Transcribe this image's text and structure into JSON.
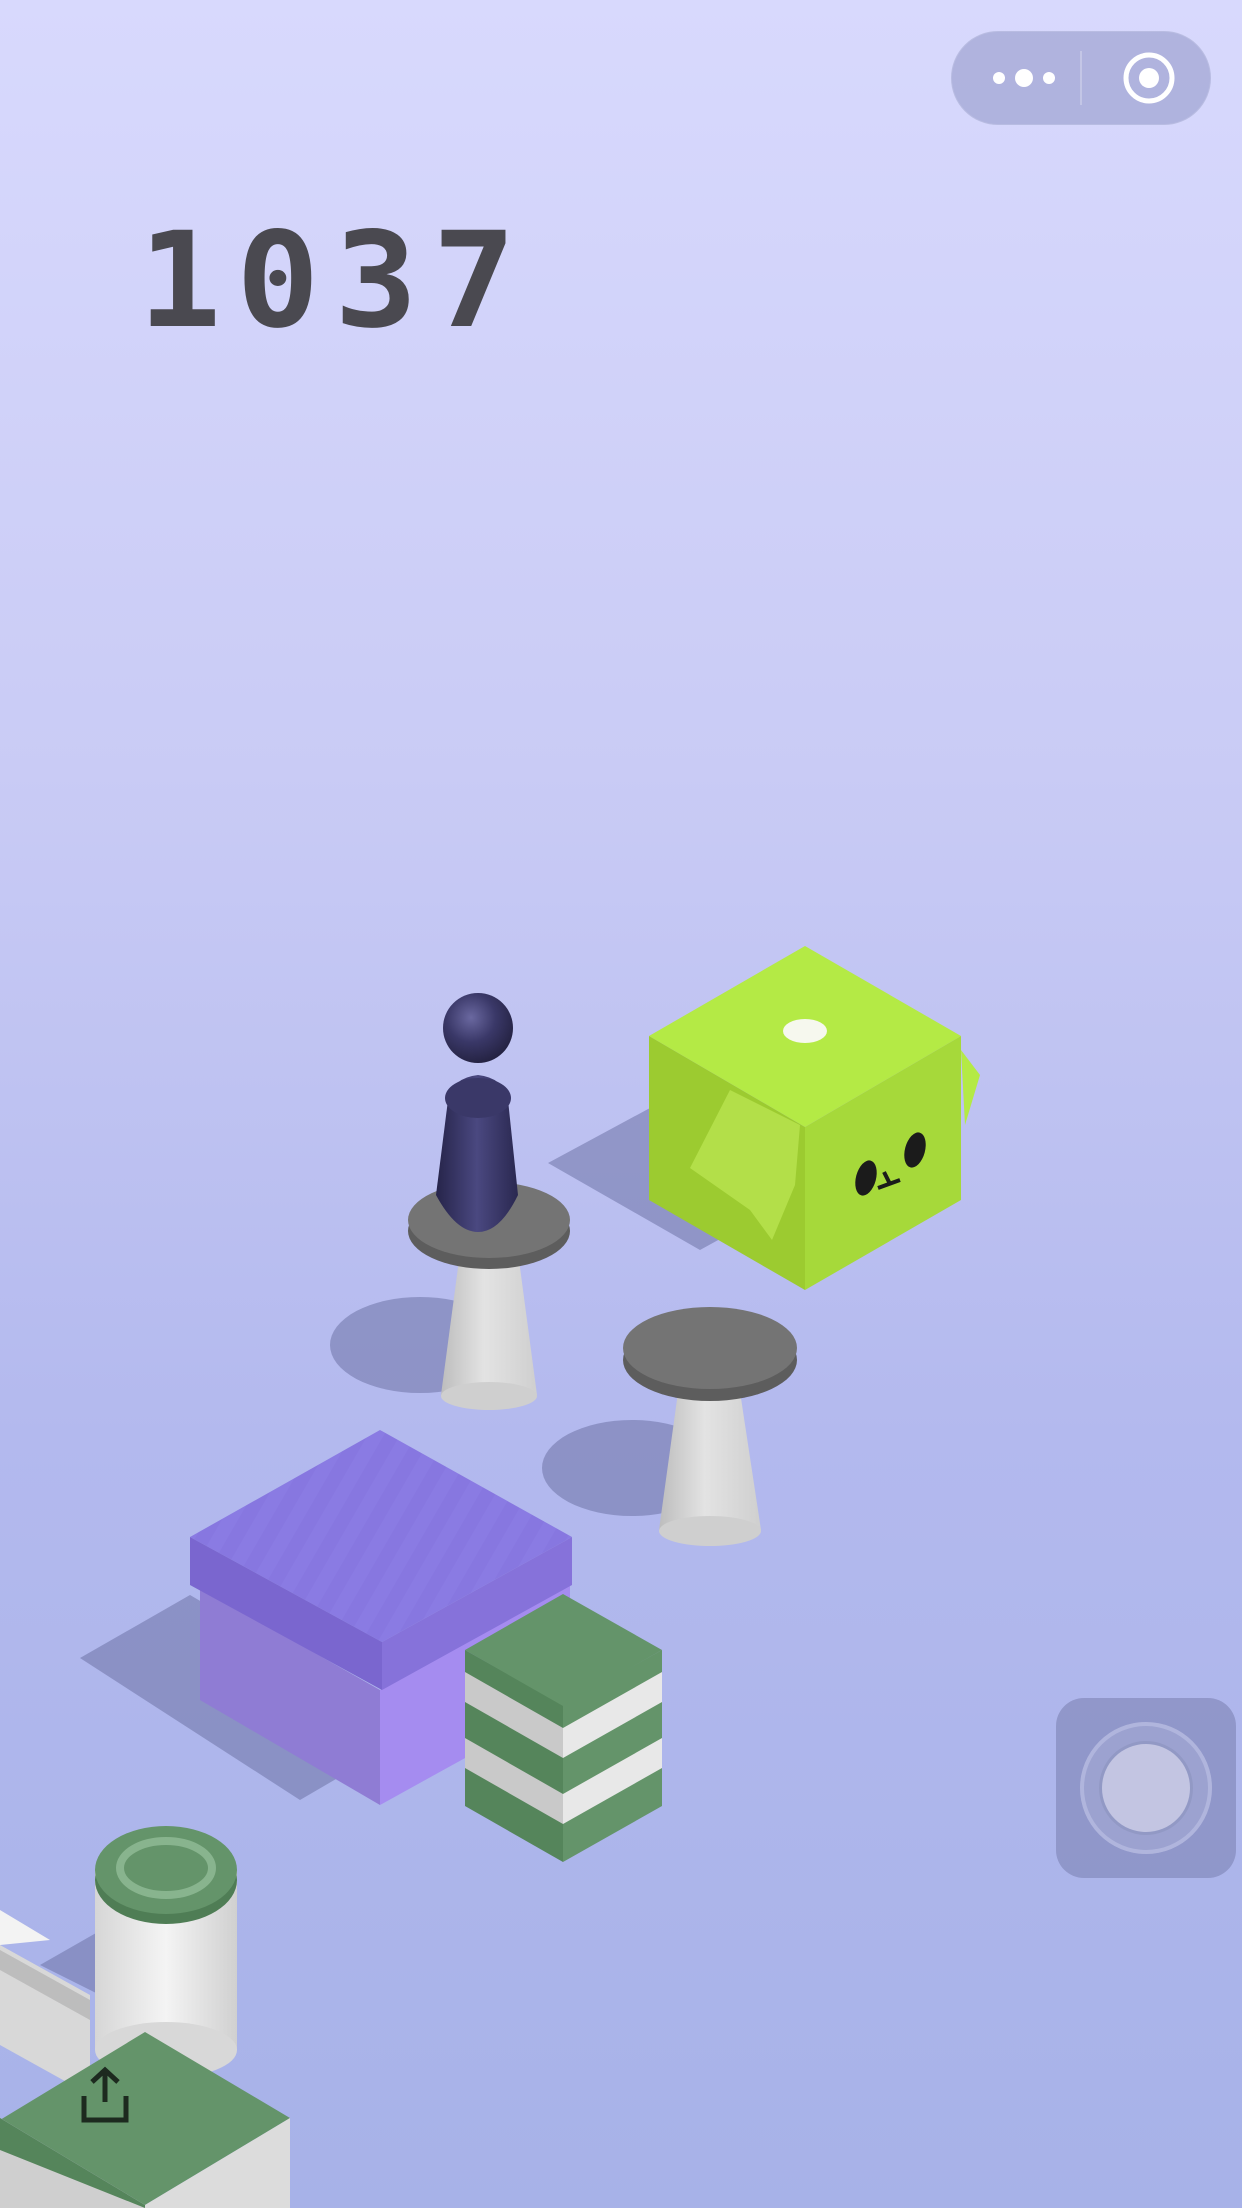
{
  "hud": {
    "score": "1037"
  },
  "capsule": {
    "more_icon": "more-dots-icon",
    "close_icon": "target-circle-icon"
  },
  "controls": {
    "hold_icon": "round-press-button",
    "share_icon": "share-upload-icon"
  },
  "colors": {
    "background_top": "#d8d9fd",
    "background_bottom": "#a7b2e8",
    "score_text": "#4a4950",
    "player": "#3a3868",
    "green_cube": "#b4ea45",
    "purple_box": "#8777e0",
    "pedestal_top": "#747474",
    "pedestal_stem": "#d7d7d7",
    "stacked_green": "#64946a"
  }
}
